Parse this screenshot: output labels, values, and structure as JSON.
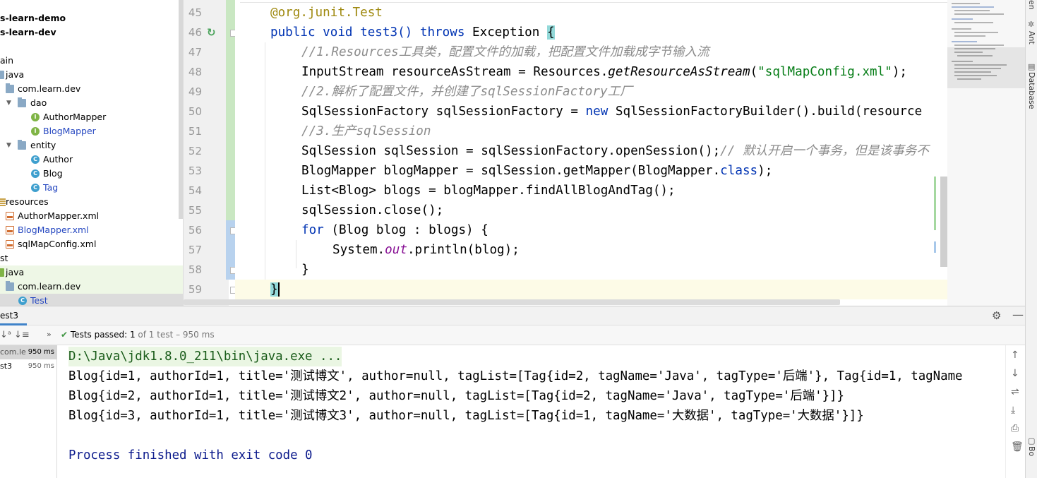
{
  "project_tree": {
    "rows": [
      {
        "label": "s-learn-demo"
      },
      {
        "label": "s-learn-dev"
      },
      {
        "label": "ain"
      },
      {
        "label": "java"
      },
      {
        "label": "com.learn.dev"
      },
      {
        "label": "dao"
      },
      {
        "label": "AuthorMapper"
      },
      {
        "label": "BlogMapper"
      },
      {
        "label": "entity"
      },
      {
        "label": "Author"
      },
      {
        "label": "Blog"
      },
      {
        "label": "Tag"
      },
      {
        "label": "resources"
      },
      {
        "label": "AuthorMapper.xml"
      },
      {
        "label": "BlogMapper.xml"
      },
      {
        "label": "sqlMapConfig.xml"
      },
      {
        "label": "st"
      },
      {
        "label": "java"
      },
      {
        "label": "com.learn.dev"
      },
      {
        "label": "Test"
      }
    ]
  },
  "editor": {
    "line_numbers": [
      "45",
      "46",
      "47",
      "48",
      "49",
      "50",
      "51",
      "52",
      "53",
      "54",
      "55",
      "56",
      "57",
      "58",
      "59"
    ],
    "lines": [
      [
        "@org.junit.",
        "Test"
      ],
      [
        "public",
        "void",
        "test3() ",
        "throws",
        " Exception ",
        "{"
      ],
      [
        "//1.Resources工具类，配置文件的加载，把配置文件加载成字节输入流"
      ],
      [
        "InputStream resourceAsStream = Resources.",
        "getResourceAsStream",
        "(",
        "\"sqlMapConfig.xml\"",
        ");"
      ],
      [
        "//2.解析了配置文件，并创建了sqlSessionFactory工厂"
      ],
      [
        "SqlSessionFactory sqlSessionFactory = ",
        "new",
        " SqlSessionFactoryBuilder().build(resource"
      ],
      [
        "//3.生产sqlSession"
      ],
      [
        "SqlSession sqlSession = sqlSessionFactory.openSession();",
        "// 默认开启一个事务，但是该事务不"
      ],
      [
        "BlogMapper blogMapper = sqlSession.getMapper(BlogMapper.",
        "class",
        ");"
      ],
      [
        "List<Blog> blogs = blogMapper.findAllBlogAndTag();"
      ],
      [
        "sqlSession.close();"
      ],
      [
        "for",
        " (Blog blog : blogs) {"
      ],
      [
        "System.",
        "out",
        ".println(blog);"
      ],
      [
        "}"
      ],
      [
        "}"
      ]
    ]
  },
  "run_panel": {
    "tab_label": "est3",
    "tests_passed_label": "Tests passed:",
    "tests_passed_count": "1",
    "tests_passed_suffix": "of 1 test – 950 ms",
    "tests": [
      {
        "name": "com.le",
        "duration": "950 ms"
      },
      {
        "name": "st3",
        "duration": "950 ms"
      }
    ],
    "console": [
      "D:\\Java\\jdk1.8.0_211\\bin\\java.exe ...",
      "Blog{id=1, authorId=1, title='测试博文', author=null, tagList=[Tag{id=2, tagName='Java', tagType='后端'}, Tag{id=1, tagName",
      "Blog{id=2, authorId=1, title='测试博文2', author=null, tagList=[Tag{id=2, tagName='Java', tagType='后端'}]}",
      "Blog{id=3, authorId=1, title='测试博文3', author=null, tagList=[Tag{id=1, tagName='大数据', tagType='大数据'}]}",
      "",
      "Process finished with exit code 0"
    ]
  },
  "right_strip": {
    "labels": [
      "en",
      "Ant",
      "Database",
      "Word Bo"
    ]
  },
  "colors": {
    "keyword": "#0033b3",
    "annotation": "#9e880d",
    "comment": "#8c8c8c",
    "string": "#067d17",
    "static_field": "#871094",
    "test_pass": "#3d9440",
    "exit_text": "#0b1a8c"
  }
}
